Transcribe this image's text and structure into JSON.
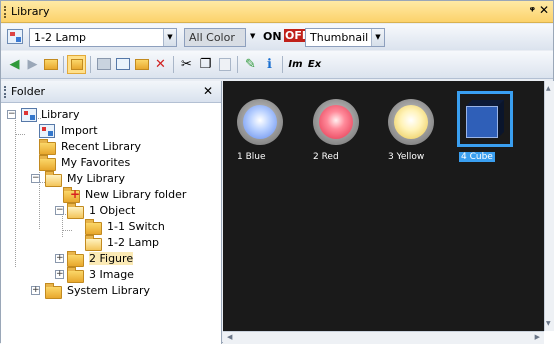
{
  "window": {
    "title": "Library",
    "pin_glyph": "ᵠ",
    "close_glyph": "✕"
  },
  "toolbar1": {
    "library_select": "1-2 Lamp",
    "color_select": "All Color",
    "on_label": "ON",
    "off_label": "OFF",
    "view_select": "Thumbnail"
  },
  "toolbar2": {
    "icons": [
      "back-icon",
      "forward-icon",
      "up-folder-icon",
      "tree-view-icon",
      "new-folder-icon",
      "register-icon",
      "import-icon",
      "delete-icon",
      "cut-icon",
      "copy-icon",
      "paste-icon",
      "edit-icon",
      "info-icon",
      "export-in-icon",
      "export-ex-icon"
    ],
    "glyphs": {
      "back": "◀",
      "forward": "▶",
      "delete": "✕",
      "cut": "✂",
      "copy": "❐",
      "paste": "📋",
      "edit": "✎",
      "info": "ℹ",
      "in": "Im",
      "ex": "Ex"
    },
    "accent_delete": "#d02020",
    "accent_nav": "#2f9a3a"
  },
  "sidebar": {
    "title": "Folder",
    "close_glyph": "✕",
    "tree": {
      "root": "Library",
      "import": "Import",
      "recent": "Recent Library",
      "favorites": "My Favorites",
      "my_library": "My Library",
      "new_folder": "New Library folder",
      "object": "1 Object",
      "switch": "1-1 Switch",
      "lamp": "1-2 Lamp",
      "figure": "2 Figure",
      "image": "3 Image",
      "system": "System Library"
    }
  },
  "items": [
    {
      "label": "1 Blue"
    },
    {
      "label": "2 Red"
    },
    {
      "label": "3 Yellow"
    },
    {
      "label": "4 Cube"
    }
  ],
  "colors": {
    "selection": "#3a9ff0",
    "viewer_bg": "#1a1a1a",
    "off_badge": "#c0211a"
  }
}
